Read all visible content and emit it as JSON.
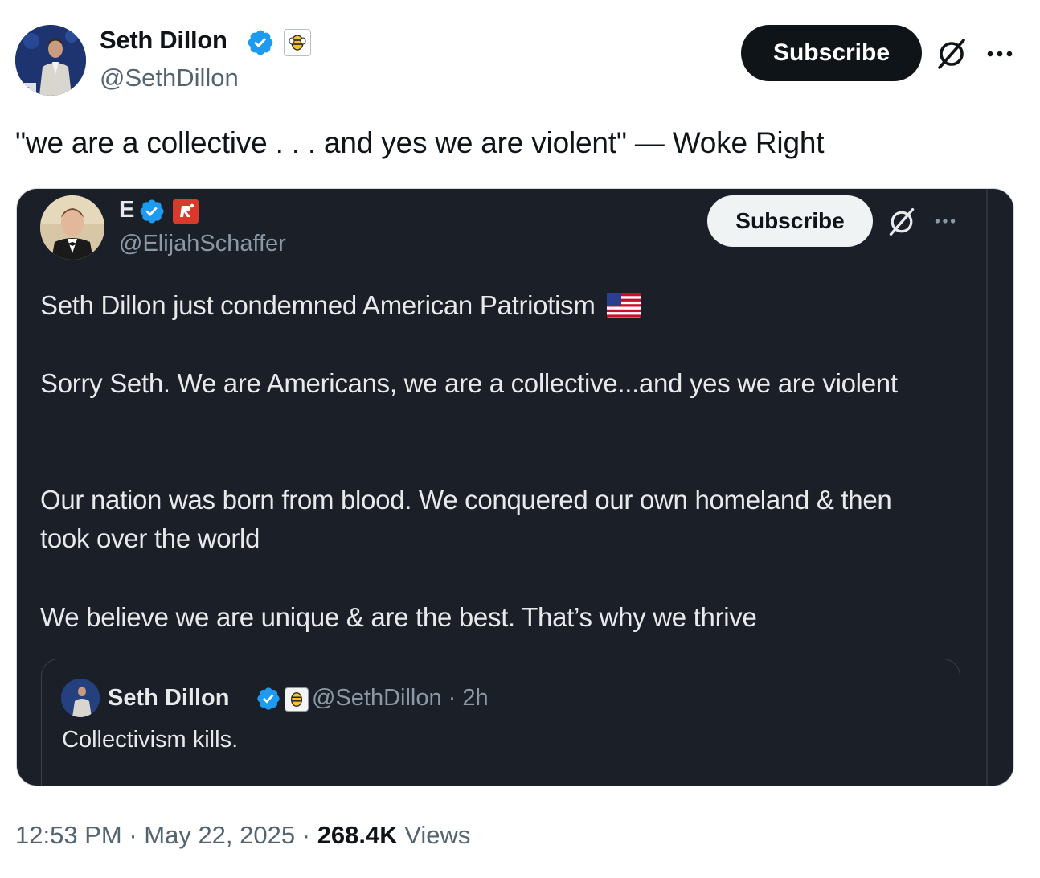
{
  "tweet": {
    "author": {
      "display_name": "Seth Dillon",
      "handle": "@SethDillon",
      "verified_icon": "verified-badge-icon",
      "affiliation_icon": "babylon-bee-logo-icon"
    },
    "subscribe_label": "Subscribe",
    "text": "\"we are a collective . . . and yes we are violent\" — Woke Right",
    "time": "12:53 PM",
    "date": "May 22, 2025",
    "views_count": "268.4K",
    "views_label": "Views"
  },
  "embedded": {
    "author": {
      "display_name": "E",
      "handle": "@ElijahSchaffer",
      "affiliation_icon": "red-affiliate-logo-icon"
    },
    "subscribe_label": "Subscribe",
    "paragraphs": [
      "Seth Dillon just condemned American Patriotism",
      "Sorry Seth. We are Americans, we are a collective...and yes we are violent",
      "Our nation was born from blood. We conquered our own homeland & then took over the world",
      "We believe we are unique & are the best. That’s why we thrive"
    ],
    "flag_icon": "us-flag-emoji",
    "quoted": {
      "display_name": "Seth Dillon",
      "meta": "@SethDillon · 2h",
      "text": "Collectivism kills."
    }
  },
  "colors": {
    "verified": "#1d9bf0",
    "button_dark": "#0f1419",
    "embedded_bg": "#1b1f28",
    "muted": "#536471"
  }
}
